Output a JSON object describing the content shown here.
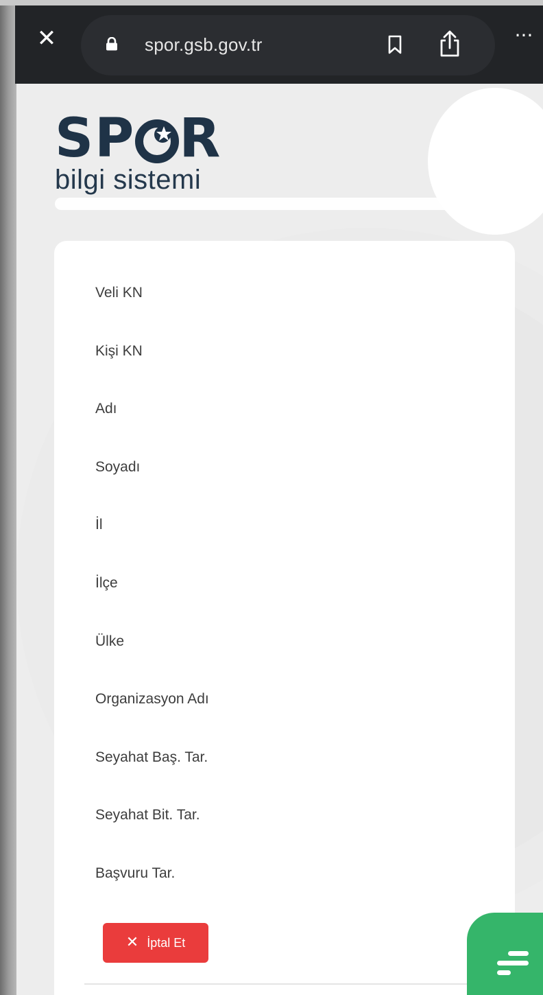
{
  "browser": {
    "url": "spor.gsb.gov.tr",
    "close_icon": "close-icon",
    "lock_icon": "lock-icon",
    "bookmark_icon": "bookmark-icon",
    "share_icon": "share-icon",
    "more_icon": "more-icon"
  },
  "logo": {
    "title_part1": "SP",
    "title_part2": "R",
    "subtitle": "bilgi sistemi"
  },
  "fields": [
    "Veli KN",
    "Kişi KN",
    "Adı",
    "Soyadı",
    "İl",
    "İlçe",
    "Ülke",
    "Organizasyon Adı",
    "Seyahat Baş. Tar.",
    "Seyahat Bit. Tar.",
    "Başvuru Tar."
  ],
  "cancel_button": {
    "label": "İptal Et",
    "icon": "close-icon"
  },
  "fab": {
    "icon": "menu-icon"
  },
  "colors": {
    "topbar": "#222427",
    "cancel_red": "#ea3c3c",
    "fab_green": "#35b56a",
    "logo_navy": "#1f3347"
  }
}
